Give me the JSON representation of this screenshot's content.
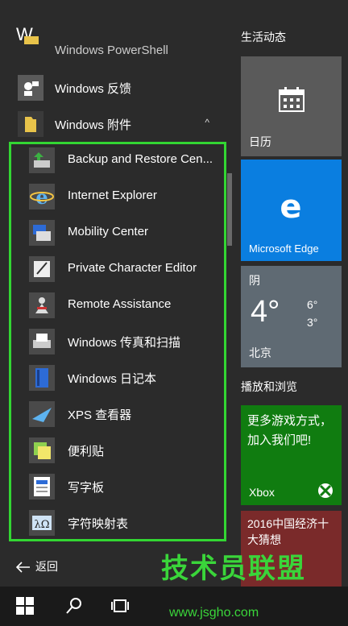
{
  "start_menu": {
    "section_letter": "W",
    "apps": [
      {
        "label": "Windows PowerShell",
        "icon": "folder-icon"
      },
      {
        "label": "Windows 反馈",
        "icon": "feedback-icon"
      },
      {
        "label": "Windows 附件",
        "icon": "folder-icon",
        "expanded": true
      }
    ],
    "accessories": [
      {
        "label": "Backup and Restore Cen...",
        "icon": "backup-icon"
      },
      {
        "label": "Internet Explorer",
        "icon": "internet-explorer-icon"
      },
      {
        "label": "Mobility Center",
        "icon": "mobility-center-icon"
      },
      {
        "label": "Private Character Editor",
        "icon": "character-editor-icon"
      },
      {
        "label": "Remote Assistance",
        "icon": "remote-assistance-icon"
      },
      {
        "label": "Windows 传真和扫描",
        "icon": "fax-scan-icon"
      },
      {
        "label": "Windows 日记本",
        "icon": "journal-icon"
      },
      {
        "label": "XPS 查看器",
        "icon": "xps-viewer-icon"
      },
      {
        "label": "便利贴",
        "icon": "sticky-notes-icon"
      },
      {
        "label": "写字板",
        "icon": "wordpad-icon"
      },
      {
        "label": "字符映射表",
        "icon": "character-map-icon"
      }
    ],
    "back_label": "返回"
  },
  "tiles": {
    "group1": "生活动态",
    "calendar": {
      "name": "日历",
      "color": "#5a5a5a"
    },
    "edge": {
      "name": "Microsoft Edge",
      "color": "#0078d7"
    },
    "weather": {
      "condition": "阴",
      "temp": "4°",
      "high": "6°",
      "low": "3°",
      "city": "北京"
    },
    "group2": "播放和浏览",
    "xbox": {
      "promo": "更多游戏方式，加入我们吧!",
      "name": "Xbox",
      "color": "#107c10"
    },
    "news": {
      "headline": "2016中国经济十大猜想"
    }
  },
  "taskbar": {
    "icons": [
      "start-icon",
      "search-icon",
      "task-view-icon"
    ]
  },
  "watermark": {
    "text": "技术员联盟",
    "url": "www.jsgho.com"
  }
}
